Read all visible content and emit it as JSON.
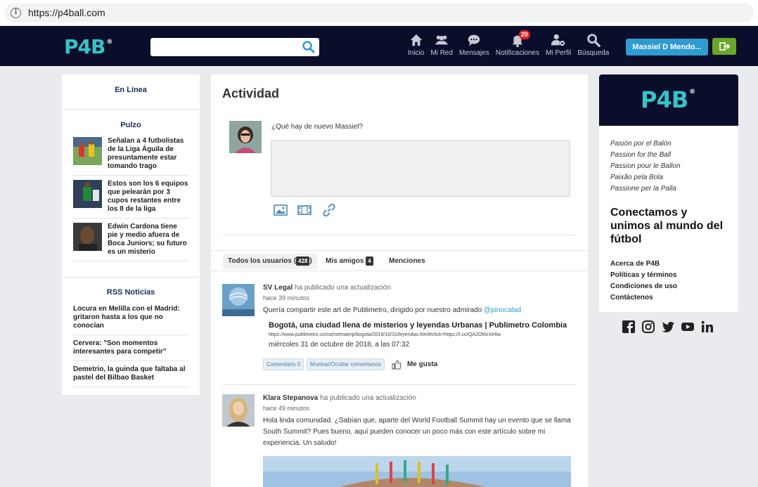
{
  "browser": {
    "url": "https://p4ball.com"
  },
  "header": {
    "logo": "P4B",
    "logo_mark": "®",
    "search_placeholder": "",
    "nav": [
      {
        "label": "Inicio",
        "icon": "home-icon"
      },
      {
        "label": "Mi Red",
        "icon": "people-icon"
      },
      {
        "label": "Mensajes",
        "icon": "chat-icon"
      },
      {
        "label": "Notificaciones",
        "icon": "bell-icon",
        "badge": "20"
      },
      {
        "label": "Mi Perfil",
        "icon": "user-gear-icon"
      },
      {
        "label": "Búsqueda",
        "icon": "search-icon"
      }
    ],
    "user_button": "Massiel D Mendo...",
    "logout_icon": "sign-out-icon"
  },
  "left": {
    "online_title": "En Línea",
    "pulzo_title": "Pulzo",
    "pulzo_items": [
      "Señalan a 4 futbolistas de la Liga Águila de presuntamente estar tomando trago",
      "Estos son los 6 equipos que pelearán por 3 cupos restantes entre los 8 de la liga",
      "Edwin Cardona tiene pie y medio afuera de Boca Juniors; su futuro es un misterio"
    ],
    "rss_title": "RSS Noticias",
    "rss_items": [
      "Locura en Melilla con el Madrid: gritaron hasta a los que no conocían",
      "Cervera: \"Son momentos interesantes para competir\"",
      "Demetrio, la guinda que faltaba al pastel del Bilbao Basket"
    ]
  },
  "center": {
    "title": "Actividad",
    "composer_prompt": "¿Qué hay de nuevo Massiel?",
    "tabs": [
      {
        "label": "Todos los usuarios (",
        "count": "428",
        "suffix": ")"
      },
      {
        "label": "Mis amigos",
        "count": "4"
      },
      {
        "label": "Menciones"
      }
    ],
    "posts": [
      {
        "author": "SV Legal",
        "action": "ha publicado una actualización",
        "time": "hace 39 minutos",
        "text": "Quería compartir este art de Publimetro, dirigido por nuestro admirado ",
        "mention": "@pinocalad",
        "link_title": "Bogotá, una ciudad llena de misterios y leyendas Urbanas | Publimetro Colombia",
        "link_url": "https://www.publimetro.co/co/metroamp/bogota/2018/10/31/leyendas.html#click=https://t.co/QA2OMzXe6w",
        "link_date": "miércoles 31 de octubre de 2018, a las 07:32",
        "comment_btn": "Comentario 0",
        "toggle_btn": "Mostrar/Ocultar comentarios",
        "like": "Me gusta"
      },
      {
        "author": "Klara Stepanova",
        "action": "ha publicado una actualización",
        "time": "hace 49 minutos",
        "text": "Hola linda comunidad. ¿Sabían que, aparte del World Football Summit hay un evento que se llama South Summit? Pues bueno, aquí pueden conocer un poco más con este artículo sobre mi experiencia. Un saludo!"
      }
    ]
  },
  "right": {
    "logo": "P4B",
    "logo_mark": "®",
    "slogans": [
      "Pasión por el Balón",
      "Passion for the Ball",
      "Passion pour le Ballon",
      "Paixão pela Bola",
      "Passione per la Palla"
    ],
    "tagline": "Conectamos y unimos al mundo del fútbol",
    "links": [
      "Acerca de P4B",
      "Políticas y términos",
      "Condiciones de uso",
      "Contáctenos"
    ],
    "social": [
      "facebook-icon",
      "instagram-icon",
      "twitter-icon",
      "youtube-icon",
      "linkedin-icon"
    ]
  },
  "colors": {
    "header_bg": "#0b0e2a",
    "brand_teal": "#34c3c9",
    "user_button": "#2e9bd1",
    "logout_button": "#6aa72a",
    "badge": "#e02020"
  }
}
